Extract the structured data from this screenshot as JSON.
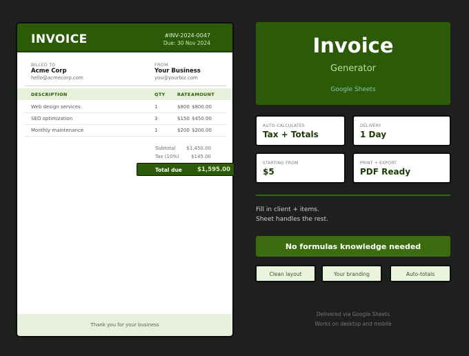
{
  "invoice": {
    "title": "INVOICE",
    "number": "#INV-2024-0047",
    "due": "Due: 30 Nov 2024",
    "billed_to": {
      "label": "BILLED TO",
      "name": "Acme Corp",
      "email": "hello@acmecorp.com"
    },
    "from": {
      "label": "FROM",
      "name": "Your Business",
      "email": "you@yourbiz.com"
    },
    "columns": [
      "DESCRIPTION",
      "QTY",
      "RATE",
      "AMOUNT"
    ],
    "rows": [
      {
        "description": "Web design services",
        "qty": "1",
        "rate": "$800",
        "amount": "$800.00"
      },
      {
        "description": "SEO optimization",
        "qty": "3",
        "rate": "$150",
        "amount": "$450.00"
      },
      {
        "description": "Monthly maintenance",
        "qty": "1",
        "rate": "$200",
        "amount": "$200.00"
      }
    ],
    "subtotal_label": "Subtotal",
    "subtotal": "$1,450.00",
    "tax_label": "Tax (10%)",
    "tax": "$145.00",
    "total_label": "Total due",
    "total": "$1,595.00",
    "footer": "Thank you for your business"
  },
  "hero": {
    "title": "Invoice",
    "subtitle": "Generator",
    "tag": "Google Sheets"
  },
  "stats": [
    {
      "label": "AUTO-CALCULATES",
      "value": "Tax + Totals"
    },
    {
      "label": "DELIVERY",
      "value": "1 Day"
    },
    {
      "label": "STARTING FROM",
      "value": "$5"
    },
    {
      "label": "PRINT + EXPORT",
      "value": "PDF Ready"
    }
  ],
  "description": {
    "line1": "Fill in client + items.",
    "line2": "Sheet handles the rest."
  },
  "cta": "No formulas knowledge needed",
  "chips": [
    "Clean layout",
    "Your branding",
    "Auto-totals"
  ],
  "notes": {
    "line1": "Delivered via Google Sheets",
    "line2": "Works on desktop and mobile"
  },
  "colors": {
    "brand_green": "#2b5a08",
    "cta_green": "#3b6d10",
    "light_green": "#e7f0da",
    "background": "#1f1f1f"
  }
}
